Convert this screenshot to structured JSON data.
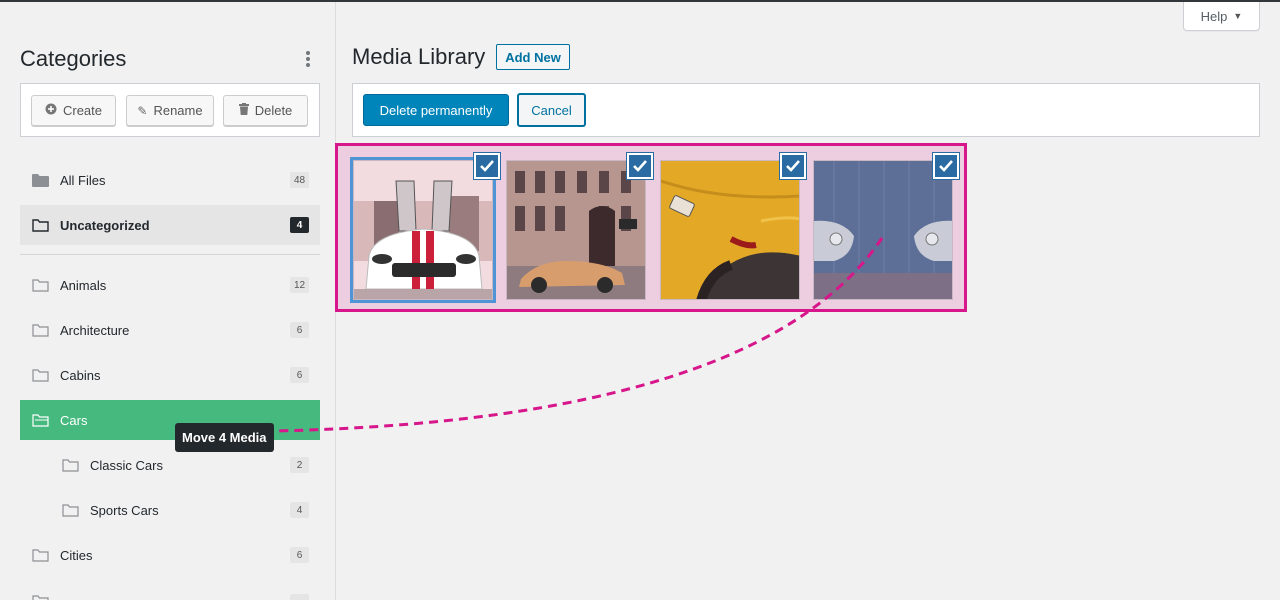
{
  "help": {
    "label": "Help"
  },
  "sidebar": {
    "title": "Categories",
    "actions": {
      "create": "Create",
      "rename": "Rename",
      "delete": "Delete"
    },
    "folders": [
      {
        "label": "All Files",
        "count": "48"
      },
      {
        "label": "Uncategorized",
        "count": "4"
      },
      {
        "label": "Animals",
        "count": "12"
      },
      {
        "label": "Architecture",
        "count": "6"
      },
      {
        "label": "Cabins",
        "count": "6"
      },
      {
        "label": "Cars",
        "count": ""
      },
      {
        "label": "Classic Cars",
        "count": "2"
      },
      {
        "label": "Sports Cars",
        "count": "4"
      },
      {
        "label": "Cities",
        "count": "6"
      }
    ],
    "tooltip": "Move 4 Media"
  },
  "main": {
    "title": "Media Library",
    "add_new": "Add New",
    "toolbar": {
      "delete_permanently": "Delete permanently",
      "cancel": "Cancel"
    },
    "media": [
      {
        "icon": "white-sports-car-photo",
        "selected": true
      },
      {
        "icon": "orange-supercar-street-photo",
        "selected": true
      },
      {
        "icon": "yellow-classic-car-photo",
        "selected": true
      },
      {
        "icon": "twin-classic-cars-photo",
        "selected": true
      }
    ]
  },
  "colors": {
    "accent_pink": "#d6168a",
    "active_folder": "#46b97f",
    "primary_button": "#0085ba",
    "check_blue": "#2a6ba3"
  }
}
